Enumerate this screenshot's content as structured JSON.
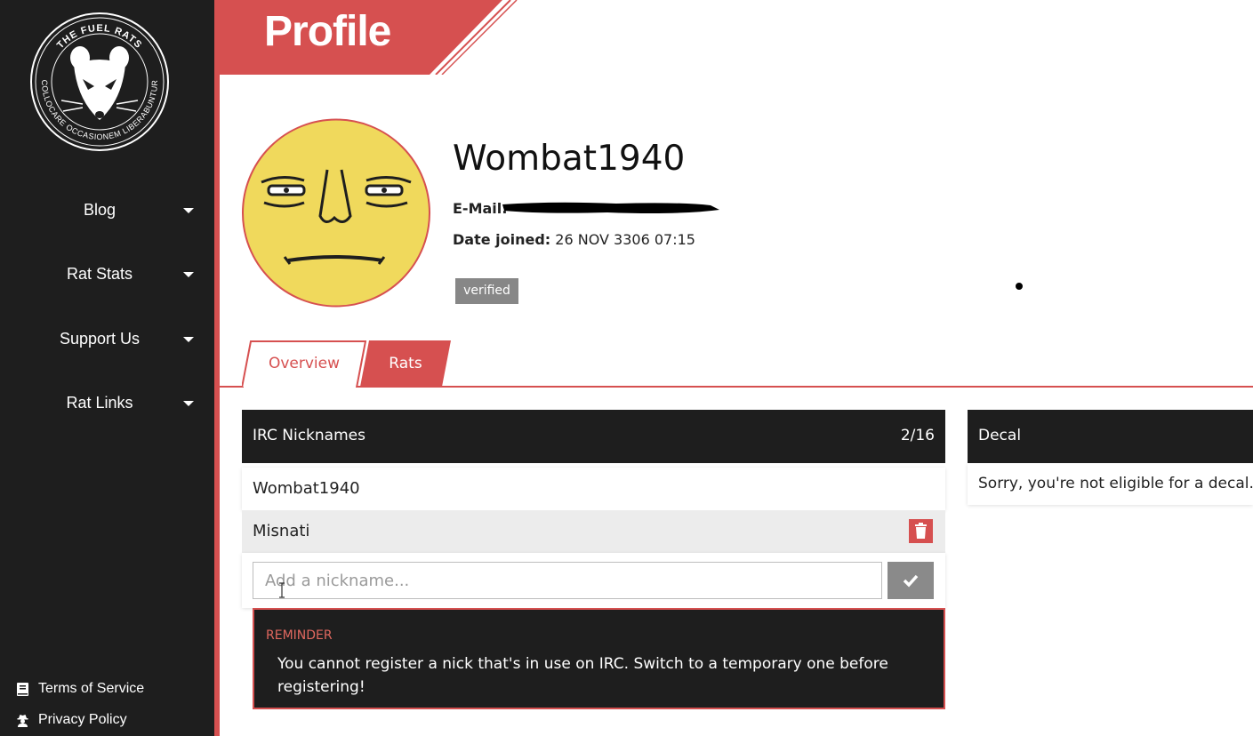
{
  "sidebar": {
    "logo": {
      "ring_top_text": "THE FUEL RATS",
      "ring_bottom_text": "COLLOCARE OCCASIONEM LIBERABUNTUR"
    },
    "nav": [
      {
        "label": "Blog"
      },
      {
        "label": "Rat Stats"
      },
      {
        "label": "Support Us"
      },
      {
        "label": "Rat Links"
      }
    ],
    "footer": [
      {
        "label": "Terms of Service",
        "icon": "book-icon"
      },
      {
        "label": "Privacy Policy",
        "icon": "user-secret-icon"
      }
    ]
  },
  "header": {
    "title": "Profile"
  },
  "profile": {
    "username": "Wombat1940",
    "email_label": "E-Mail:",
    "date_label": "Date joined:",
    "date_value": "26 NOV 3306 07:15",
    "badge": "verified"
  },
  "tabs": [
    {
      "label": "Overview",
      "active": true
    },
    {
      "label": "Rats",
      "active": false
    }
  ],
  "irc": {
    "title": "IRC Nicknames",
    "count": "2/16",
    "nicknames": [
      {
        "name": "Wombat1940"
      },
      {
        "name": "Misnati"
      }
    ],
    "input_placeholder": "Add a nickname..."
  },
  "reminder": {
    "title": "REMINDER",
    "text": "You cannot register a nick that's in use on IRC. Switch to a temporary one before registering!"
  },
  "decal": {
    "title": "Decal",
    "message": "Sorry, you're not eligible for a decal."
  },
  "colors": {
    "accent": "#d65050",
    "dark": "#1e1e1e",
    "badge": "#878787",
    "avatar_fill": "#f0d95c"
  }
}
